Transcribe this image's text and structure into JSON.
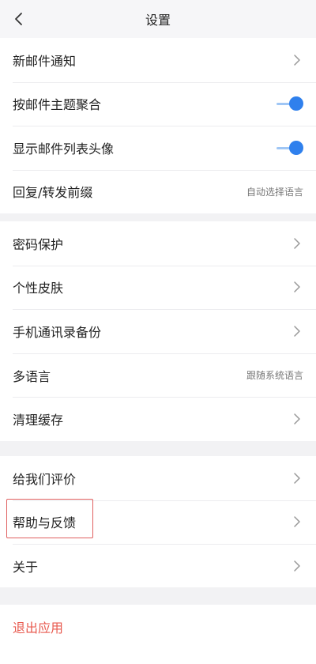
{
  "header": {
    "title": "设置",
    "back_icon": "chevron-left-icon"
  },
  "group1": {
    "new_mail": "新邮件通知",
    "thread_by_subject": "按邮件主题聚合",
    "thread_by_subject_on": true,
    "show_avatar": "显示邮件列表头像",
    "show_avatar_on": true,
    "reply_prefix": "回复/转发前缀",
    "reply_prefix_value": "自动选择语言"
  },
  "group2": {
    "password": "密码保护",
    "skin": "个性皮肤",
    "contacts_backup": "手机通讯录备份",
    "language": "多语言",
    "language_value": "跟随系统语言",
    "clear_cache": "清理缓存"
  },
  "group3": {
    "rate": "给我们评价",
    "help": "帮助与反馈",
    "about": "关于"
  },
  "group4": {
    "exit": "退出应用"
  },
  "colors": {
    "accent": "#2f80ed",
    "exit": "#e85a4f",
    "highlight": "#e06060"
  }
}
